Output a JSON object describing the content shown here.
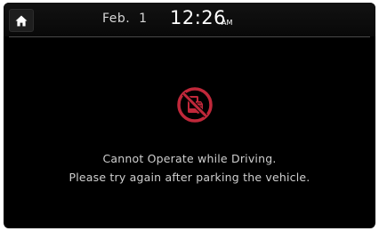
{
  "status_bar": {
    "home_icon": "home-icon",
    "date": "Feb.  1",
    "time": "12:26",
    "ampm": "AM"
  },
  "alert": {
    "icon": "no-phone-while-driving-icon",
    "icon_color": "#c0283a",
    "line1": "Cannot Operate while Driving.",
    "line2": "Please try again after parking the vehicle."
  }
}
